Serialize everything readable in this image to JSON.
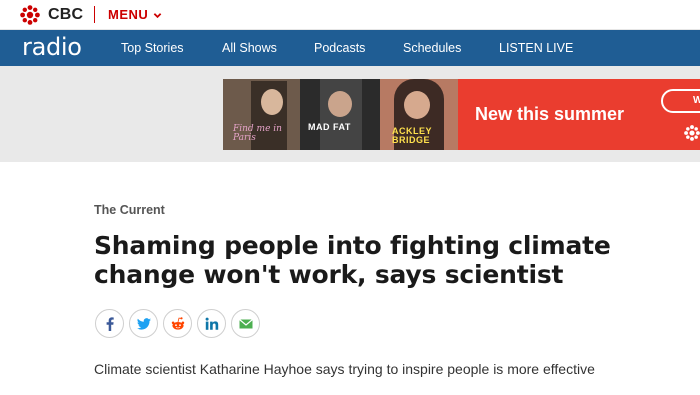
{
  "topbar": {
    "brand": "CBC",
    "menu_label": "MENU",
    "brand_color": "#cc0000"
  },
  "nav": {
    "logo": "radio",
    "items": [
      "Top Stories",
      "All Shows",
      "Podcasts",
      "Schedules",
      "LISTEN LIVE"
    ],
    "bg_color": "#1f5d94"
  },
  "ad": {
    "headline": "New this summer",
    "caption_1": "Find me in Paris",
    "caption_2": "MAD FAT",
    "caption_3": "ACKLEY BRIDGE",
    "pill_text": "W",
    "accent": "#ea3d2f"
  },
  "article": {
    "kicker": "The Current",
    "headline": "Shaming people into fighting climate change won't work, says scientist",
    "deck": "Climate scientist Katharine Hayhoe says trying to inspire people is more effective"
  },
  "share": [
    {
      "icon": "facebook-icon",
      "color": "#3b5998"
    },
    {
      "icon": "twitter-icon",
      "color": "#1da1f2"
    },
    {
      "icon": "reddit-icon",
      "color": "#ff4500"
    },
    {
      "icon": "linkedin-icon",
      "color": "#0e76a8"
    },
    {
      "icon": "email-icon",
      "color": "#4caf50"
    }
  ]
}
